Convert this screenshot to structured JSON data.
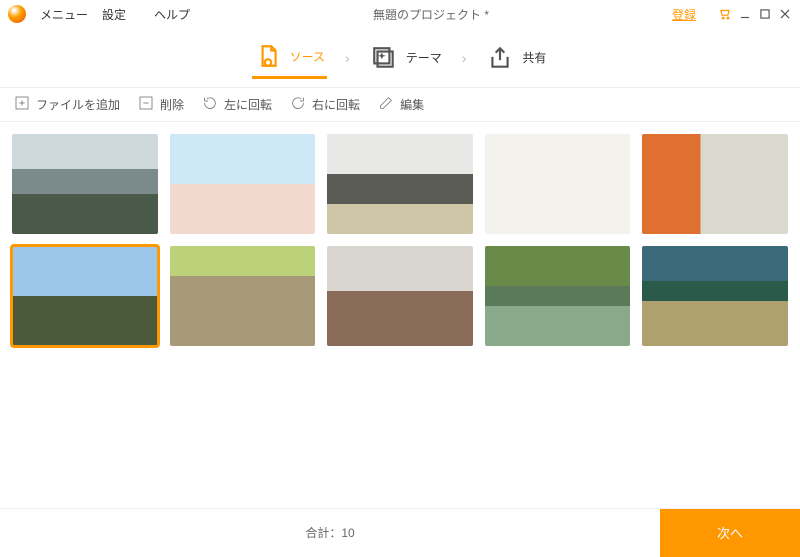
{
  "menubar": {
    "items": [
      "メニュー",
      "設定",
      "ヘルプ"
    ],
    "title": "無題のプロジェクト *",
    "register": "登録"
  },
  "steps": {
    "source": "ソース",
    "theme": "テーマ",
    "share": "共有"
  },
  "toolbar": {
    "add": "ファイルを追加",
    "delete": "削除",
    "rotate_left": "左に回転",
    "rotate_right": "右に回転",
    "edit": "編集"
  },
  "gallery": {
    "selected_index": 5,
    "count": 10
  },
  "footer": {
    "total_label": "合計：10",
    "next": "次へ"
  }
}
